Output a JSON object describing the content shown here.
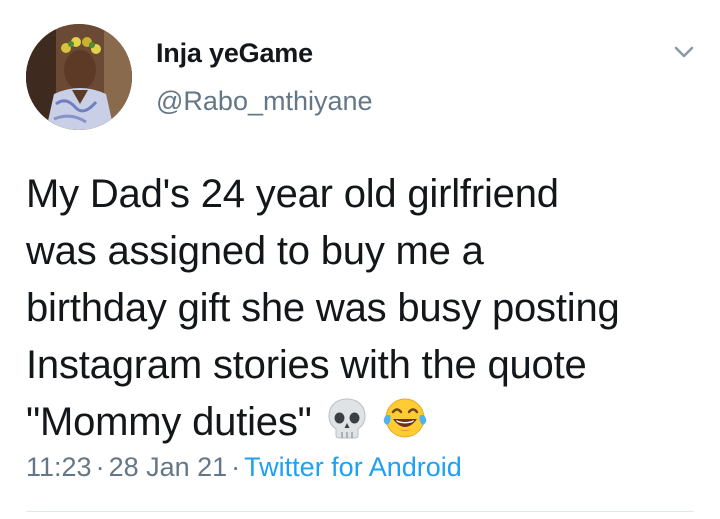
{
  "tweet": {
    "author": {
      "display_name": "Inja yeGame",
      "handle": "@Rabo_mthiyane"
    },
    "text_lines": [
      "My Dad's 24 year old girlfriend",
      "was assigned to buy me a",
      "birthday gift she was busy posting",
      "Instagram stories with the quote",
      "\"Mommy duties\""
    ],
    "emojis": [
      "skull-emoji",
      "face-with-tears-of-joy-emoji"
    ],
    "time": "11:23",
    "separator": "·",
    "date": "28 Jan 21",
    "source": "Twitter for Android"
  },
  "colors": {
    "text": "#14171a",
    "secondary": "#657786",
    "link": "#1da1f2",
    "divider": "#e1e8ed"
  }
}
